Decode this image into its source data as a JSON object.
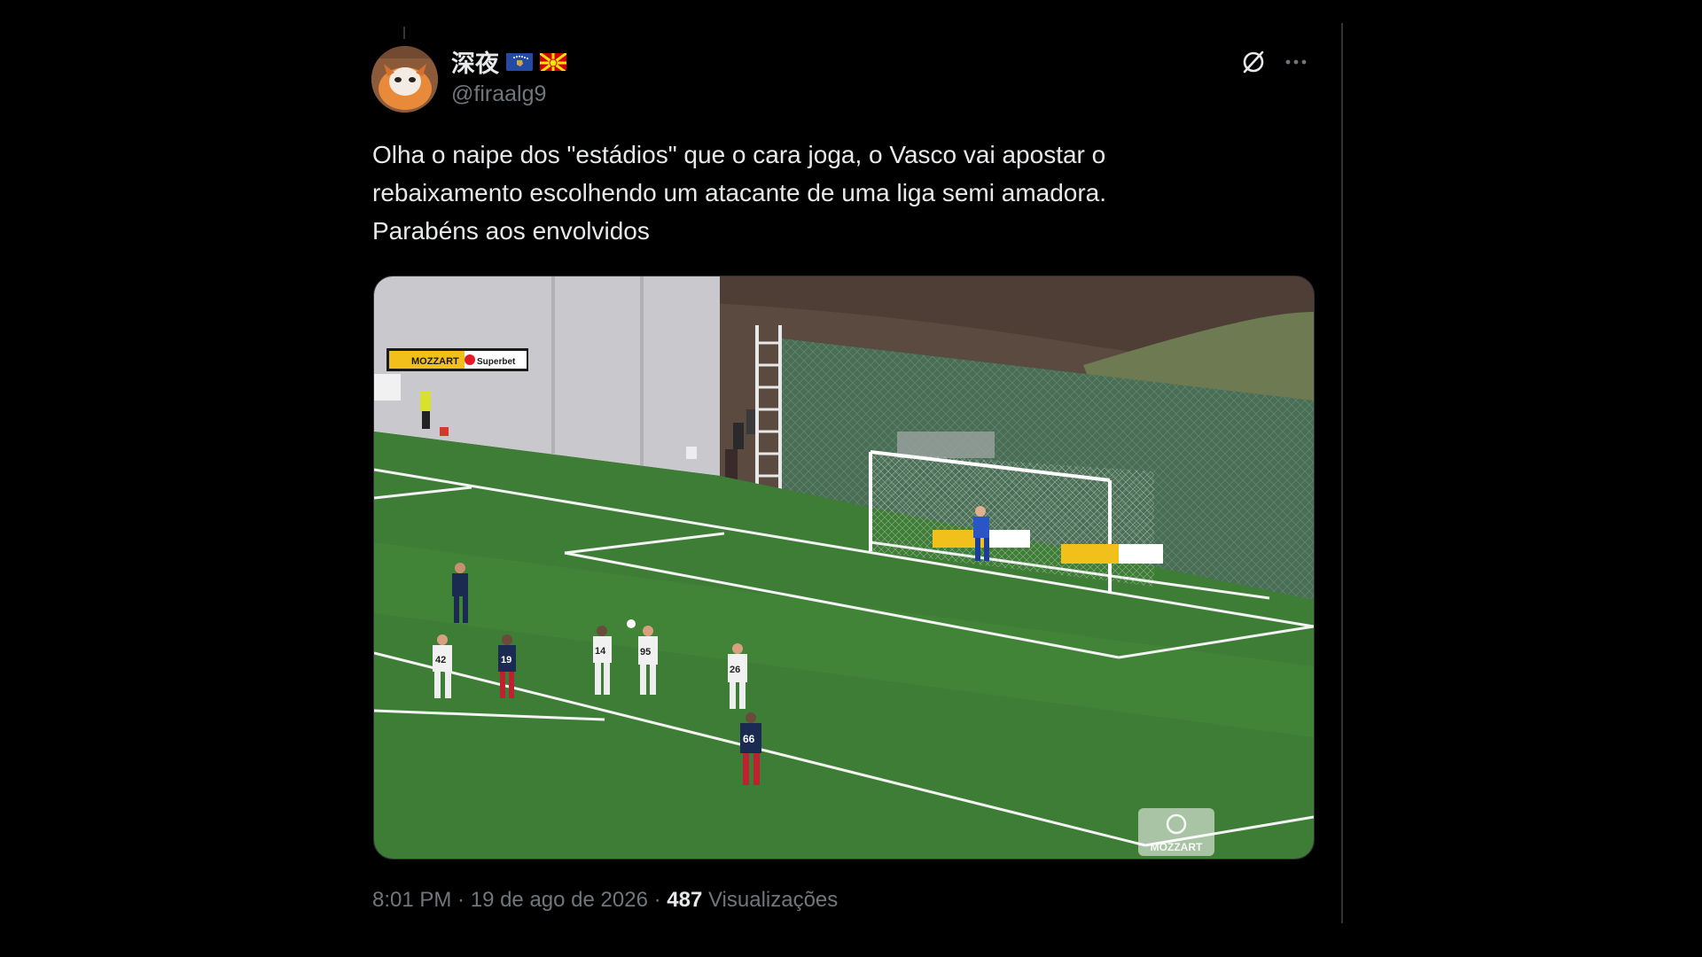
{
  "author": {
    "display_name": "深夜",
    "handle": "@firaalg9",
    "flags": [
      "kosovo-flag",
      "north-macedonia-flag"
    ]
  },
  "actions": {
    "grok_icon": "slashed-circle-icon",
    "more_icon": "more-horizontal-icon"
  },
  "tweet": {
    "lines": [
      "Olha o naipe dos \"estádios\" que o cara joga, o Vasco vai apostar o",
      "rebaixamento escolhendo um atacante de uma liga semi amadora.",
      "Parabéns aos envolvidos"
    ]
  },
  "media": {
    "sponsor_board_labels": [
      "MOZZART",
      "Superbet"
    ],
    "watermark": "MOZZART",
    "shirt_numbers": [
      "42",
      "19",
      "14",
      "95",
      "26",
      "66"
    ]
  },
  "meta": {
    "time": "8:01 PM",
    "separator": " · ",
    "date": "19 de ago de 2026",
    "views_count": "487",
    "views_label": "Visualizações"
  },
  "colors": {
    "background": "#000000",
    "text_primary": "#e7e9ea",
    "text_secondary": "#71767b",
    "pitch_green": "#3e7d35",
    "net_green": "#466e52"
  }
}
